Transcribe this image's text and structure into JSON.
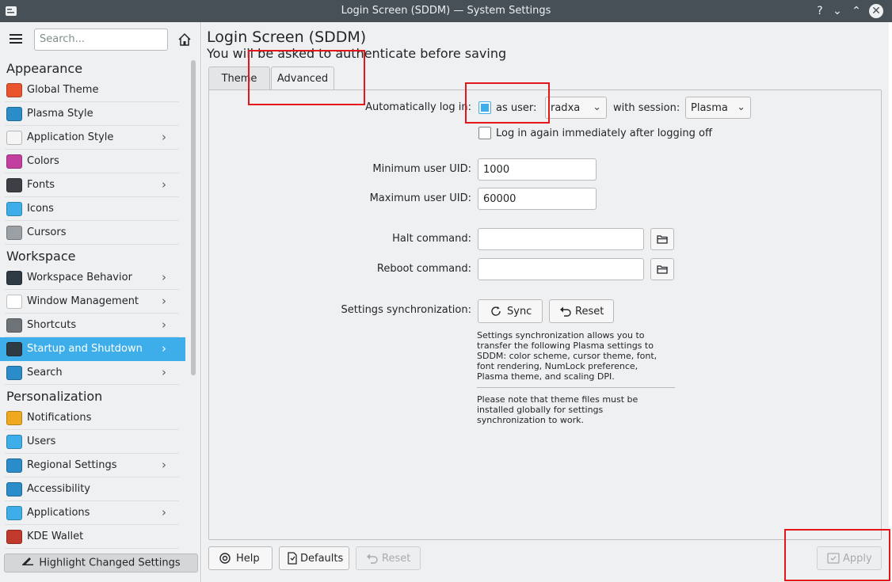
{
  "window": {
    "title": "Login Screen (SDDM) — System Settings",
    "controls": [
      "?",
      "⌄",
      "⌃",
      "✕"
    ]
  },
  "sidebar": {
    "search_placeholder": "Search...",
    "categories": [
      {
        "name": "Appearance",
        "items": [
          {
            "label": "Global Theme",
            "icon": "global-theme-icon",
            "chevron": false,
            "color": "#e9542f"
          },
          {
            "label": "Plasma Style",
            "icon": "plasma-style-icon",
            "chevron": false,
            "color": "#2a8cc9"
          },
          {
            "label": "Application Style",
            "icon": "application-style-icon",
            "chevron": true,
            "color": "#f5f5f5"
          },
          {
            "label": "Colors",
            "icon": "colors-icon",
            "chevron": false,
            "color": "#c23fa0"
          },
          {
            "label": "Fonts",
            "icon": "fonts-icon",
            "chevron": true,
            "color": "#3c4044"
          },
          {
            "label": "Icons",
            "icon": "icons-icon",
            "chevron": false,
            "color": "#3daee9"
          },
          {
            "label": "Cursors",
            "icon": "cursors-icon",
            "chevron": false,
            "color": "#9aa0a4"
          }
        ]
      },
      {
        "name": "Workspace",
        "items": [
          {
            "label": "Workspace Behavior",
            "icon": "workspace-behavior-icon",
            "chevron": true,
            "color": "#2e3a44"
          },
          {
            "label": "Window Management",
            "icon": "window-management-icon",
            "chevron": true,
            "color": "#ffffff"
          },
          {
            "label": "Shortcuts",
            "icon": "shortcuts-icon",
            "chevron": true,
            "color": "#6e7377"
          },
          {
            "label": "Startup and Shutdown",
            "icon": "startup-shutdown-icon",
            "chevron": true,
            "color": "#2e3a44",
            "active": true
          },
          {
            "label": "Search",
            "icon": "search-icon",
            "chevron": true,
            "color": "#2a8cc9"
          }
        ]
      },
      {
        "name": "Personalization",
        "items": [
          {
            "label": "Notifications",
            "icon": "notifications-icon",
            "chevron": false,
            "color": "#f0a81f"
          },
          {
            "label": "Users",
            "icon": "users-icon",
            "chevron": false,
            "color": "#3daee9"
          },
          {
            "label": "Regional Settings",
            "icon": "regional-settings-icon",
            "chevron": true,
            "color": "#2a8cc9"
          },
          {
            "label": "Accessibility",
            "icon": "accessibility-icon",
            "chevron": false,
            "color": "#2a8cc9"
          },
          {
            "label": "Applications",
            "icon": "applications-icon",
            "chevron": true,
            "color": "#3daee9"
          },
          {
            "label": "KDE Wallet",
            "icon": "kde-wallet-icon",
            "chevron": false,
            "color": "#c0392b"
          }
        ]
      }
    ],
    "highlight_button": "Highlight Changed Settings"
  },
  "main": {
    "title": "Login Screen (SDDM)",
    "subtitle": "You will be asked to authenticate before saving",
    "tabs": [
      {
        "label": "Theme",
        "active": false
      },
      {
        "label": "Advanced",
        "active": true
      }
    ],
    "autologin": {
      "label": "Automatically log in:",
      "as_user_label": "as user:",
      "checked": true,
      "user_value": "radxa",
      "session_label": "with session:",
      "session_value": "Plasma",
      "relogin_label": "Log in again immediately after logging off",
      "relogin_checked": false
    },
    "uid": {
      "min_label": "Minimum user UID:",
      "min_value": "1000",
      "max_label": "Maximum user UID:",
      "max_value": "60000"
    },
    "commands": {
      "halt_label": "Halt command:",
      "halt_value": "",
      "reboot_label": "Reboot command:",
      "reboot_value": ""
    },
    "sync": {
      "label": "Settings synchronization:",
      "sync_button": "Sync",
      "reset_button": "Reset",
      "note1": [
        "Settings synchronization allows you to",
        "transfer the following Plasma settings to",
        "SDDM: color scheme, cursor theme, font,",
        "font rendering, NumLock preference,",
        "Plasma theme, and scaling DPI."
      ],
      "note2": [
        "Please note that theme files must be",
        "installed globally for settings",
        "synchronization to work."
      ]
    },
    "footer": {
      "help": "Help",
      "defaults": "Defaults",
      "reset": "Reset",
      "apply": "Apply"
    }
  },
  "colors": {
    "accent": "#3daee9",
    "titlebar": "#475057",
    "highlight_box": "#e3171b"
  }
}
